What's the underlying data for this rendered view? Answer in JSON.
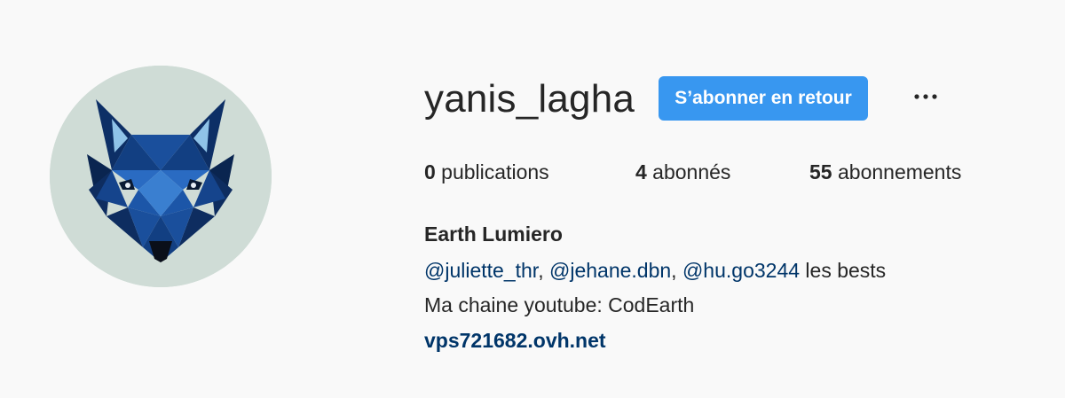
{
  "profile": {
    "avatar_icon": "wolf-avatar",
    "username": "yanis_lagha",
    "follow_button_label": "S’abonner en retour",
    "more_icon": "more-options-icon",
    "accent_color": "#3897f0",
    "link_color": "#003569"
  },
  "stats": {
    "posts_count": "0",
    "posts_label": " publications",
    "followers_count": "4",
    "followers_label": " abonnés",
    "following_count": "55",
    "following_label": " abonnements"
  },
  "bio": {
    "full_name": "Earth Lumiero",
    "mentions": [
      "@juliette_thr",
      "@jehane.dbn",
      "@hu.go3244"
    ],
    "separator": ", ",
    "mention_suffix": " les bests",
    "line2": "Ma chaine youtube: CodEarth",
    "website": "vps721682.ovh.net"
  }
}
